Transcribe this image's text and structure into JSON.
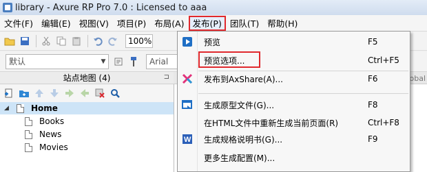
{
  "window": {
    "title": "library - Axure RP Pro 7.0 : Licensed to aaa"
  },
  "menubar": {
    "items": [
      {
        "label": "文件(F)"
      },
      {
        "label": "编辑(E)"
      },
      {
        "label": "视图(V)"
      },
      {
        "label": "项目(P)"
      },
      {
        "label": "布局(A)"
      },
      {
        "label": "发布(P)"
      },
      {
        "label": "团队(T)"
      },
      {
        "label": "帮助(H)"
      }
    ]
  },
  "toolbar": {
    "zoom": "100%",
    "style_select": "默认",
    "font_select": "Arial"
  },
  "sitemap": {
    "header": "站点地图 (4)",
    "home": "Home",
    "pages": [
      "Books",
      "News",
      "Movies"
    ]
  },
  "canvas": {
    "tab_label": "Global"
  },
  "publish_menu": {
    "items": [
      {
        "label": "预览",
        "shortcut": "F5",
        "icon": "preview-icon"
      },
      {
        "label": "预览选项...",
        "shortcut": "Ctrl+F5",
        "icon": ""
      },
      {
        "label": "发布到AxShare(A)...",
        "shortcut": "F6",
        "icon": "axshare-icon"
      },
      {
        "label": "生成原型文件(G)...",
        "shortcut": "F8",
        "icon": "generate-prototype-icon"
      },
      {
        "label": "在HTML文件中重新生成当前页面(R)",
        "shortcut": "Ctrl+F8",
        "icon": ""
      },
      {
        "label": "生成规格说明书(G)...",
        "shortcut": "F9",
        "icon": "word-icon"
      },
      {
        "label": "更多生成配置(M)...",
        "shortcut": "",
        "icon": ""
      }
    ]
  },
  "colors": {
    "highlight_red": "#e0282c",
    "selection_blue": "#cde4f7"
  }
}
